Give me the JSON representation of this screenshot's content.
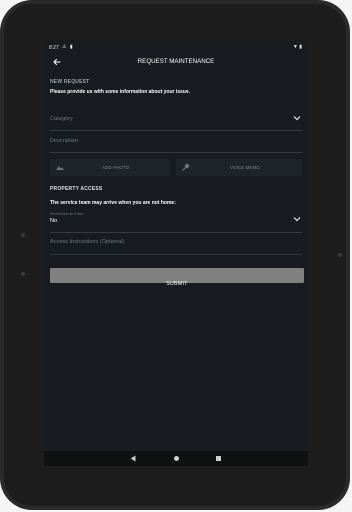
{
  "status_bar": {
    "time": "8:27"
  },
  "toolbar": {
    "title": "REQUEST MAINTENANCE"
  },
  "new_request": {
    "section_title": "NEW REQUEST",
    "intro": "Please provide us with some information about your issue.",
    "category_placeholder": "Category",
    "description_placeholder": "Description",
    "add_photo_label": "ADD PHOTO",
    "voice_memo_label": "VOICE MEMO"
  },
  "property_access": {
    "section_title": "PROPERTY ACCESS",
    "prompt": "The service team may arrive when you are not home:",
    "permission_label": "Permission to Enter",
    "permission_value": "No",
    "access_placeholder": "Access Instructions (Optional)"
  },
  "actions": {
    "submit_label": "SUBMIT"
  },
  "colors": {
    "screen_bg": "#181c20",
    "submit_bg": "#808080",
    "divider": "#343a40",
    "muted_text": "#6f7780"
  }
}
